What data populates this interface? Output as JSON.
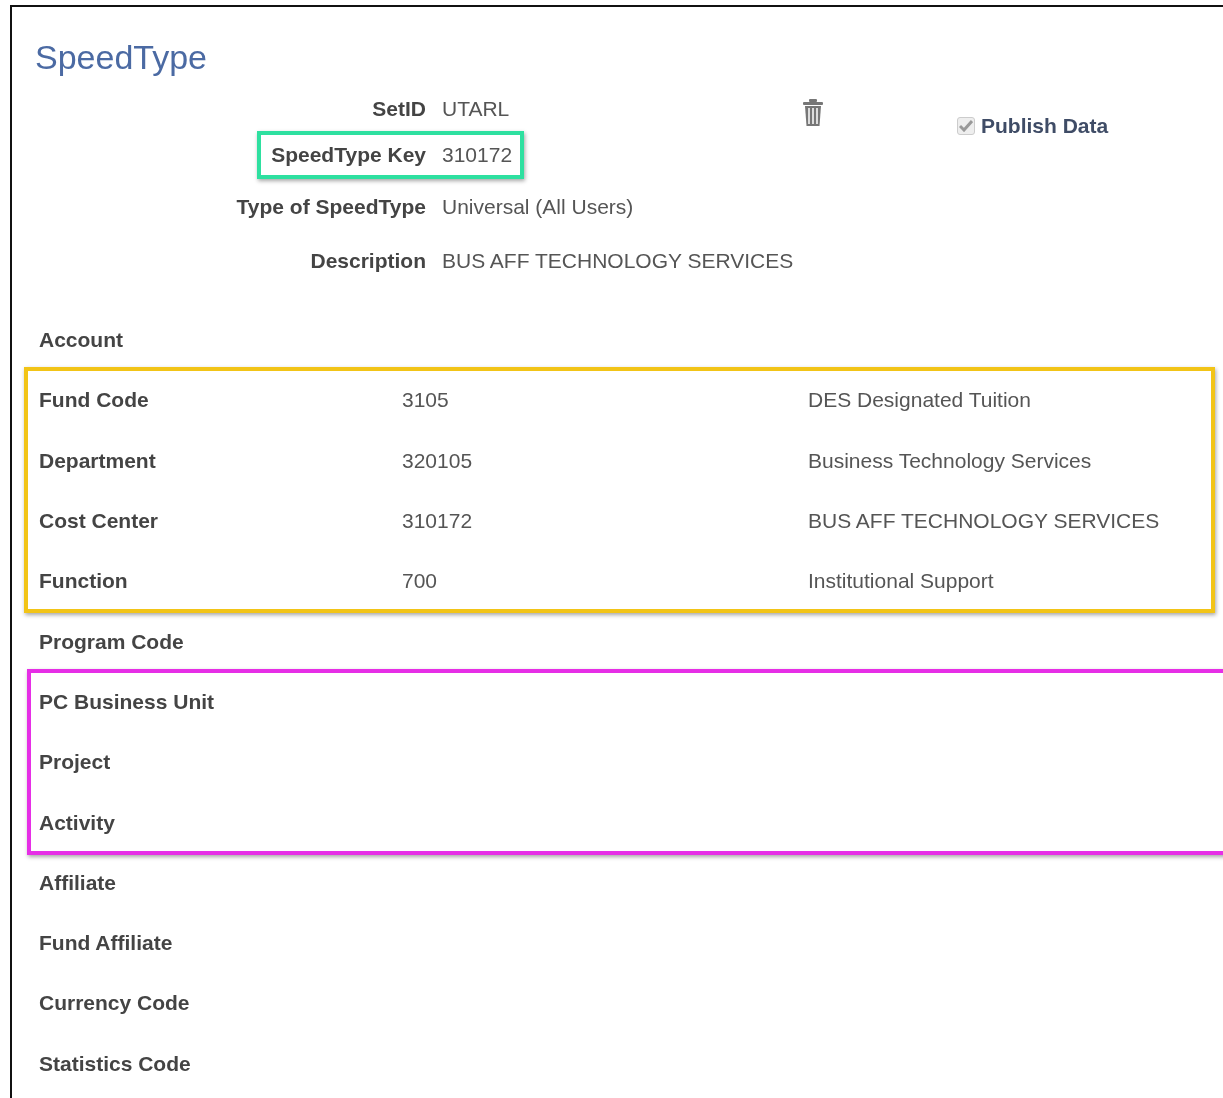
{
  "title": "SpeedType",
  "header_fields": [
    {
      "label": "SetID",
      "value": "UTARL"
    },
    {
      "label": "SpeedType Key",
      "value": "310172",
      "color": "#2ee0a0"
    },
    {
      "label": "Type of SpeedType",
      "value": "Universal (All Users)"
    },
    {
      "label": "Description",
      "value": "BUS AFF TECHNOLOGY SERVICES"
    }
  ],
  "publish_data": {
    "label": "Publish Data",
    "checked": true,
    "disabled": true
  },
  "sections": [
    {
      "rows": [
        {
          "label": "Account"
        }
      ]
    },
    {
      "color": "#f2c417",
      "rows": [
        {
          "label": "Fund Code",
          "value": "3105",
          "description": "DES Designated Tuition"
        },
        {
          "label": "Department",
          "value": "320105",
          "description": "Business Technology Services"
        },
        {
          "label": "Cost Center",
          "value": "310172",
          "description": "BUS AFF TECHNOLOGY SERVICES"
        },
        {
          "label": "Function",
          "value": "700",
          "description": "Institutional Support"
        }
      ]
    },
    {
      "rows": [
        {
          "label": "Program Code"
        }
      ]
    },
    {
      "color": "#e62ee6",
      "rows": [
        {
          "label": "PC Business Unit"
        },
        {
          "label": "Project"
        },
        {
          "label": "Activity"
        }
      ]
    },
    {
      "rows": [
        {
          "label": "Affiliate"
        },
        {
          "label": "Fund Affiliate"
        },
        {
          "label": "Currency Code"
        },
        {
          "label": "Statistics Code"
        }
      ]
    }
  ]
}
